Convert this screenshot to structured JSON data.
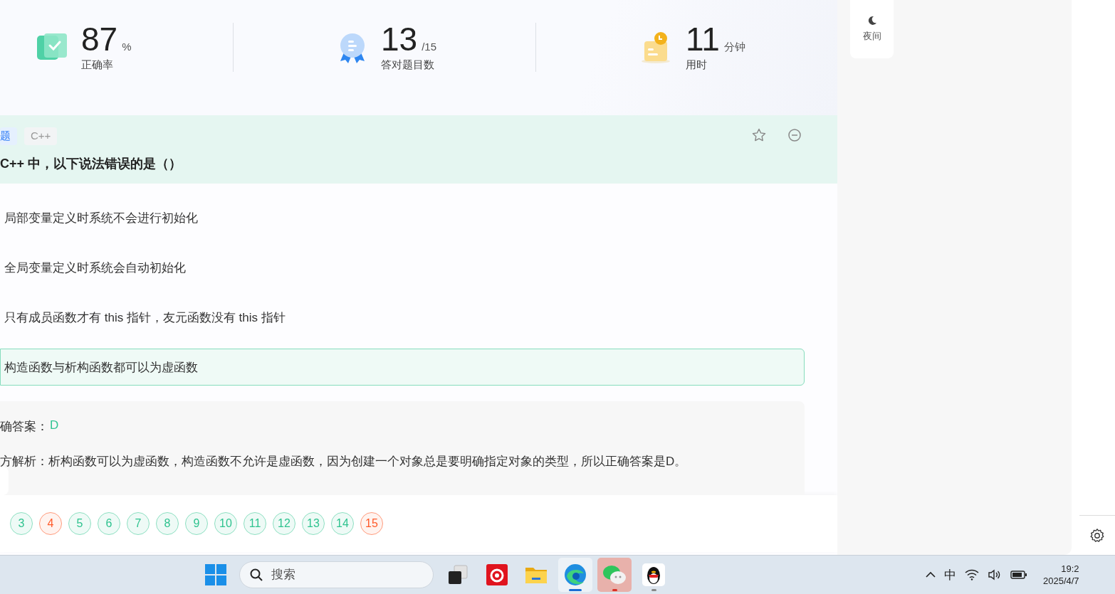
{
  "stats": [
    {
      "kind": "accuracy",
      "value": "87",
      "unit": "%",
      "label": "正确率"
    },
    {
      "kind": "count",
      "value": "13",
      "unit": "/15",
      "label": "答对题目数"
    },
    {
      "kind": "time",
      "value": "11",
      "unit": "分钟",
      "label": "用时"
    }
  ],
  "question": {
    "tags": [
      {
        "kind": "type",
        "text": "题"
      },
      {
        "kind": "topic",
        "text": "C++"
      }
    ],
    "title": "C++ 中，以下说法错误的是（）",
    "favorited": false
  },
  "options": [
    {
      "text": "局部变量定义时系统不会进行初始化",
      "highlighted": false
    },
    {
      "text": "全局变量定义时系统会自动初始化",
      "highlighted": false
    },
    {
      "text": "只有成员函数才有 this 指针，友元函数没有 this 指针",
      "highlighted": false
    },
    {
      "text": "构造函数与析构函数都可以为虚函数",
      "highlighted": true
    }
  ],
  "answer": {
    "label": "确答案：",
    "value": "D",
    "analysis": "方解析：析构函数可以为虚函数，构造函数不允许是虚函数，因为创建一个对象总是要明确指定对象的类型，所以正确答案是D。"
  },
  "navigator": [
    {
      "number": "3",
      "kind": "correct"
    },
    {
      "number": "4",
      "kind": "wrong"
    },
    {
      "number": "5",
      "kind": "correct"
    },
    {
      "number": "6",
      "kind": "correct"
    },
    {
      "number": "7",
      "kind": "correct"
    },
    {
      "number": "8",
      "kind": "correct"
    },
    {
      "number": "9",
      "kind": "correct"
    },
    {
      "number": "10",
      "kind": "correct"
    },
    {
      "number": "11",
      "kind": "correct"
    },
    {
      "number": "12",
      "kind": "correct"
    },
    {
      "number": "13",
      "kind": "correct"
    },
    {
      "number": "14",
      "kind": "correct"
    },
    {
      "number": "15",
      "kind": "wrong"
    }
  ],
  "side_panel": {
    "night_label": "夜间"
  },
  "taskbar": {
    "search_placeholder": "搜索",
    "apps": [
      {
        "kind": "task-view",
        "running": false,
        "selected": false,
        "flashing": false
      },
      {
        "kind": "music",
        "running": false,
        "selected": false,
        "flashing": false
      },
      {
        "kind": "folder",
        "running": false,
        "selected": false,
        "flashing": false
      },
      {
        "kind": "browser",
        "running": true,
        "selected": true,
        "flashing": false
      },
      {
        "kind": "chat",
        "running": true,
        "selected": false,
        "flashing": true
      },
      {
        "kind": "penguin",
        "running": true,
        "selected": false,
        "flashing": false
      }
    ],
    "tray": {
      "ime": "中",
      "time": "19:2",
      "date": "2025/4/7"
    }
  }
}
